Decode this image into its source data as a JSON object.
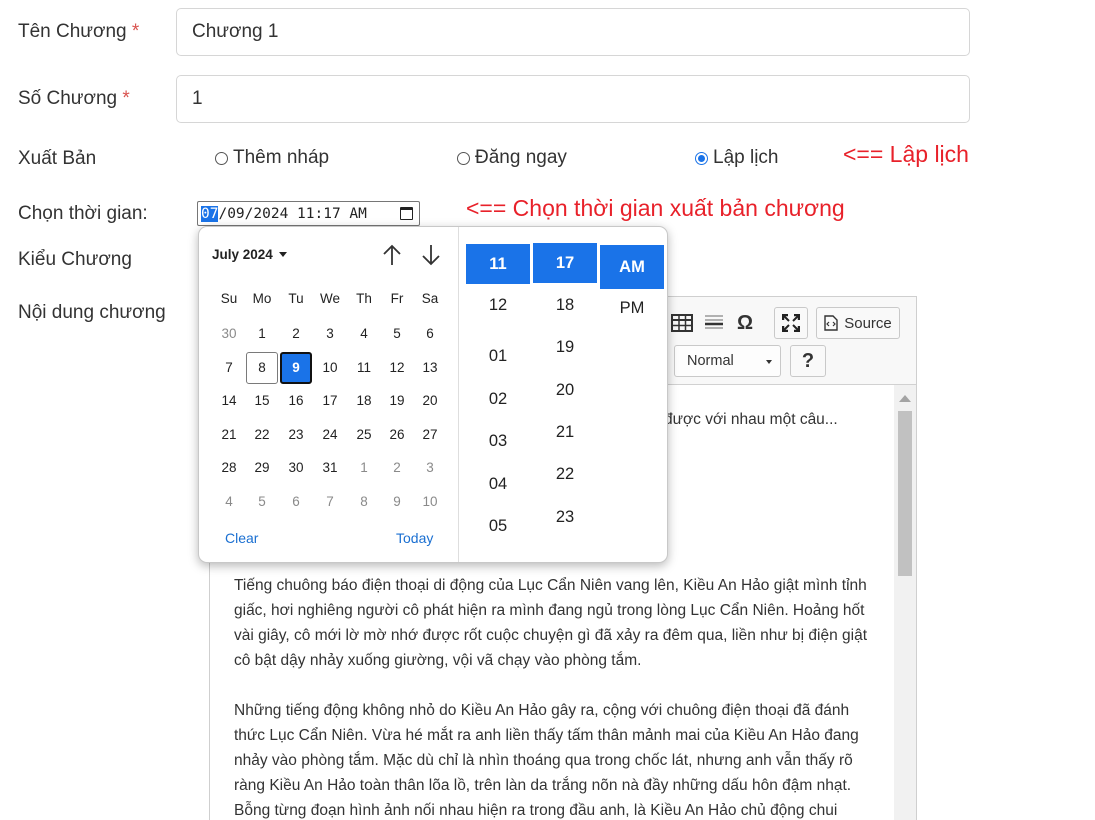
{
  "form": {
    "chapter_name": {
      "label": "Tên Chương",
      "required_mark": "*",
      "value": "Chương 1"
    },
    "chapter_number": {
      "label": "Số Chương",
      "required_mark": "*",
      "value": "1"
    },
    "publish": {
      "label": "Xuất Bản",
      "options": [
        "Thêm nháp",
        "Đăng ngay",
        "Lập lịch"
      ],
      "selected": "Lập lịch"
    },
    "schedule": {
      "label": "Chọn thời gian:",
      "value_month": "07",
      "value_rest": "/09/2024 11:17 AM"
    },
    "chapter_type": {
      "label": "Kiểu Chương"
    },
    "content": {
      "label": "Nội dung chương"
    }
  },
  "annotations": {
    "publish_note": "<== Lập lịch",
    "time_note": "<== Chọn thời gian xuất bản chương"
  },
  "picker": {
    "month_label": "July 2024",
    "weekdays": [
      "Su",
      "Mo",
      "Tu",
      "We",
      "Th",
      "Fr",
      "Sa"
    ],
    "weeks": [
      [
        "30",
        "1",
        "2",
        "3",
        "4",
        "5",
        "6"
      ],
      [
        "7",
        "8",
        "9",
        "10",
        "11",
        "12",
        "13"
      ],
      [
        "14",
        "15",
        "16",
        "17",
        "18",
        "19",
        "20"
      ],
      [
        "21",
        "22",
        "23",
        "24",
        "25",
        "26",
        "27"
      ],
      [
        "28",
        "29",
        "30",
        "31",
        "1",
        "2",
        "3"
      ],
      [
        "4",
        "5",
        "6",
        "7",
        "8",
        "9",
        "10"
      ]
    ],
    "today_day": "8",
    "selected_day": "9",
    "clear_label": "Clear",
    "today_label": "Today",
    "hours": [
      "11",
      "12",
      "01",
      "02",
      "03",
      "04",
      "05"
    ],
    "minutes": [
      "17",
      "18",
      "19",
      "20",
      "21",
      "22",
      "23"
    ],
    "periods": [
      "AM",
      "PM"
    ],
    "selected_hour": "11",
    "selected_minute": "17",
    "selected_period": "AM"
  },
  "editor": {
    "source_label": "Source",
    "format_select": "Normal",
    "help_label": "?",
    "partial_line": "được với nhau một câu...",
    "paragraphs": [
      "Tiếng chuông báo điện thoại di động của Lục Cẩn Niên vang lên, Kiều An Hảo giật mình tỉnh giấc, hơi nghiêng người cô phát hiện ra mình đang ngủ trong lòng Lục Cẩn Niên. Hoảng hốt vài giây, cô mới lờ mờ nhớ được rốt cuộc chuyện gì đã xảy ra đêm qua, liền như bị điện giật cô bật dậy nhảy xuống giường, vội vã chạy vào phòng tắm.",
      "Những tiếng động không nhỏ do Kiều An Hảo gây ra, cộng với chuông điện thoại đã đánh thức Lục Cẩn Niên. Vừa hé mắt ra anh liền thấy tấm thân mảnh mai của Kiều An Hảo đang nhảy vào phòng tắm. Mặc dù chỉ là nhìn thoáng qua trong chốc lát, nhưng anh vẫn thấy rõ ràng Kiều An Hảo toàn thân lõa lồ, trên làn da trắng nõn nà đầy những dấu hôn đậm nhạt. Bỗng từng đoạn hình ảnh nối nhau hiện ra trong đầu anh, là Kiều An Hảo chủ động chui"
    ]
  },
  "colors": {
    "accent": "#1a73e8",
    "annotation": "#e8212a",
    "required": "#d9534f"
  }
}
